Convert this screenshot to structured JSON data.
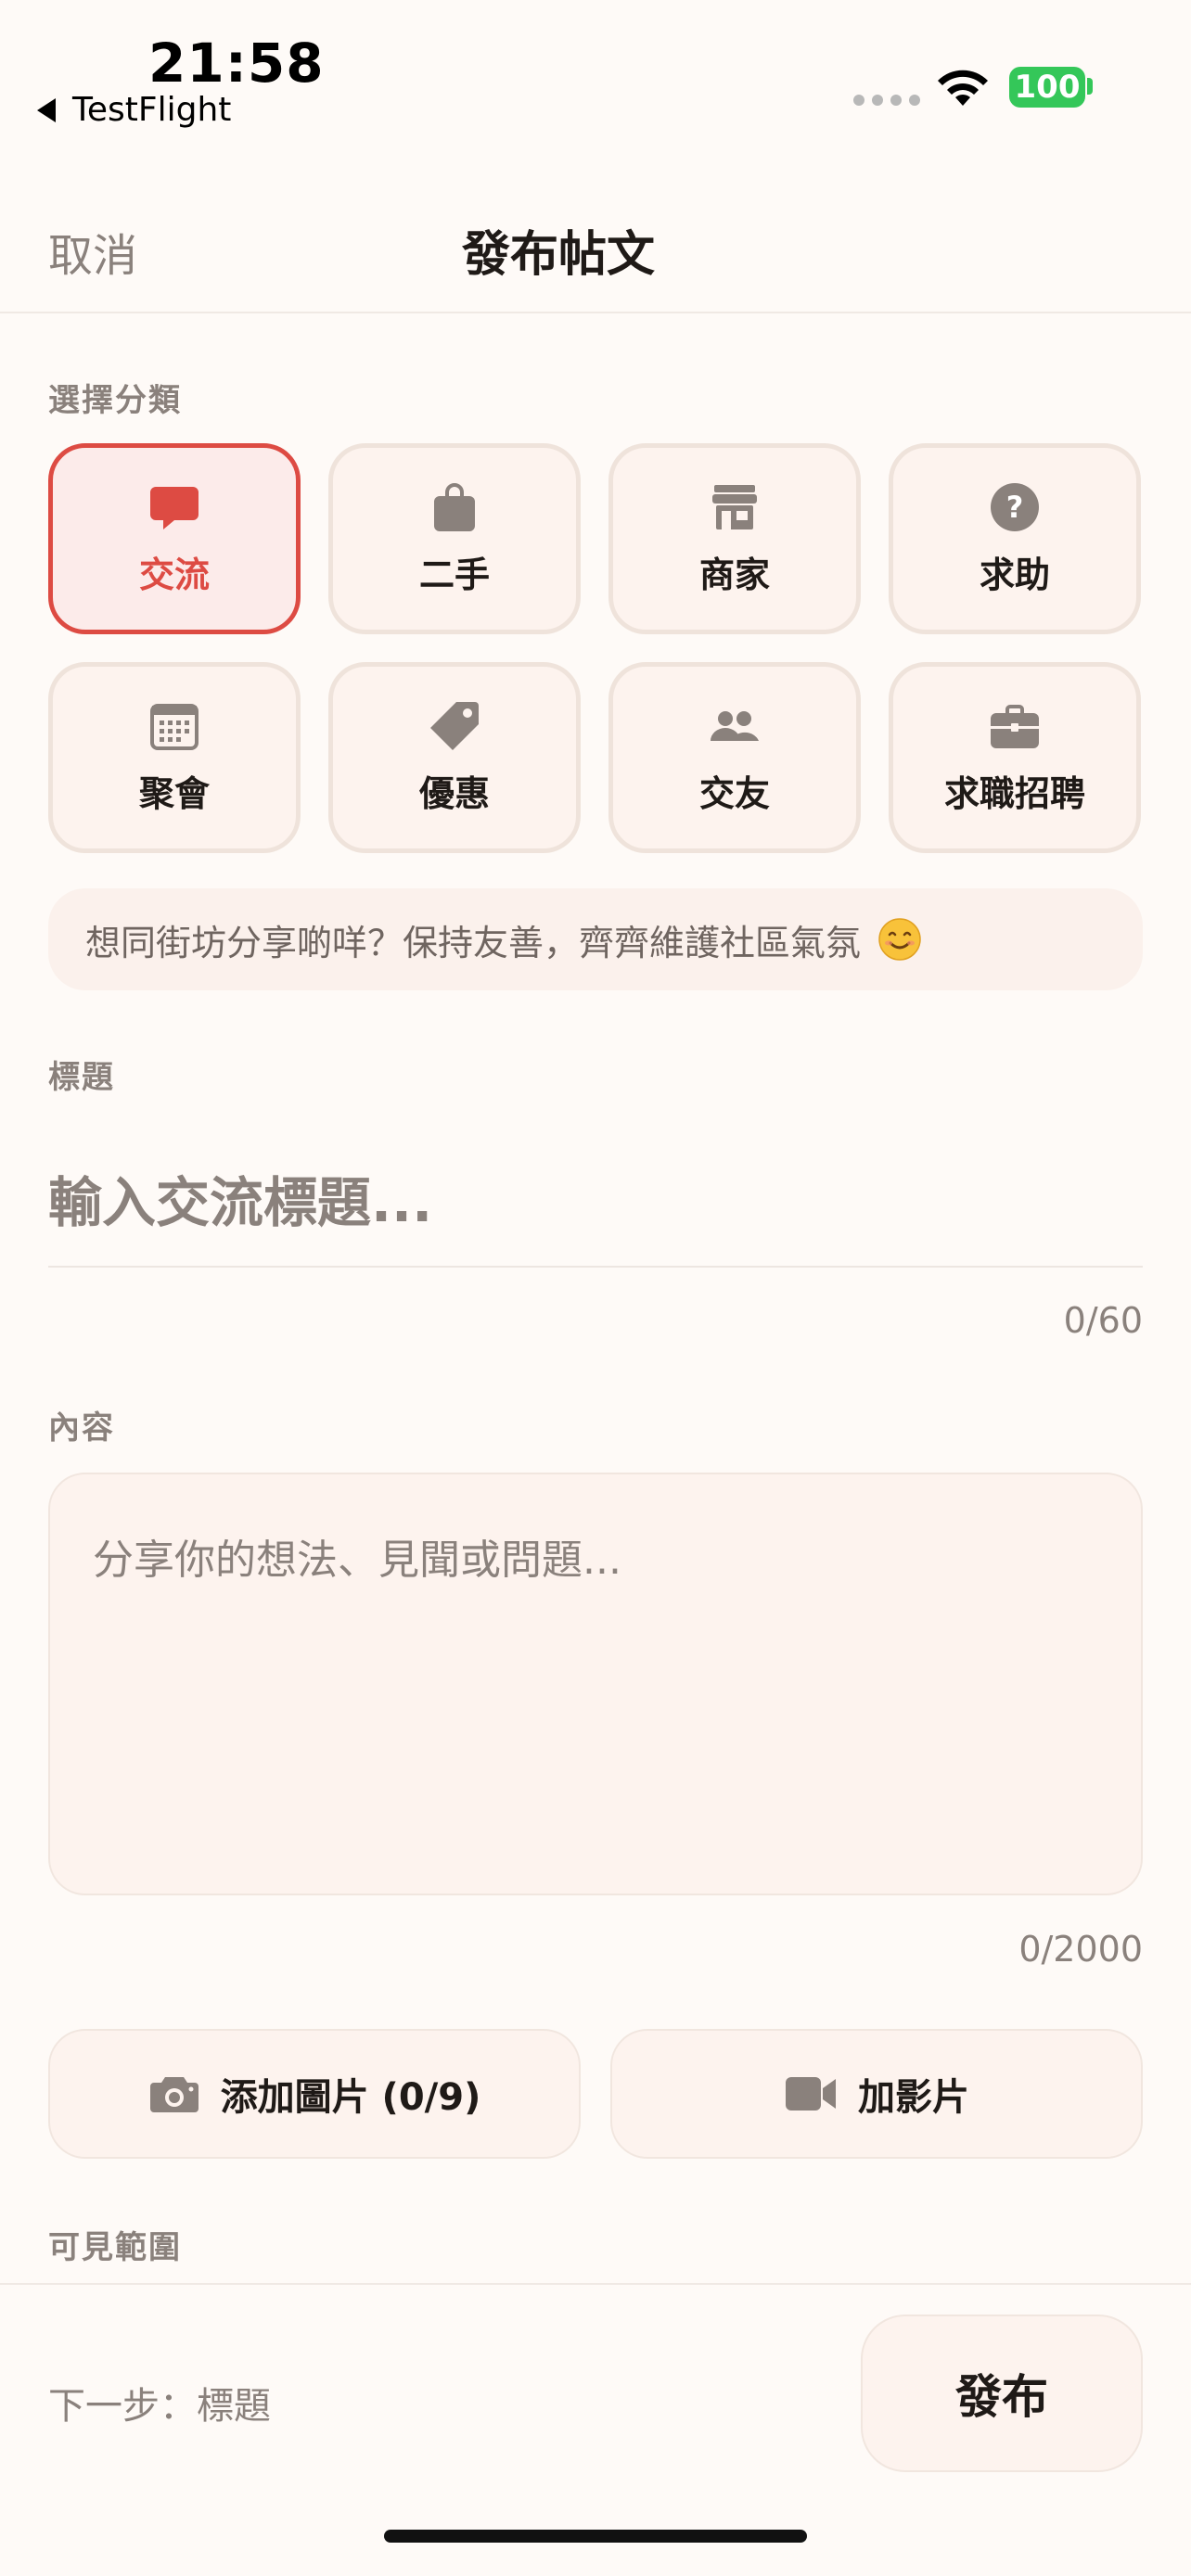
{
  "status_bar": {
    "time": "21:58",
    "back_app": "TestFlight",
    "battery": "100"
  },
  "nav": {
    "cancel": "取消",
    "title": "發布帖文"
  },
  "category_section": {
    "label": "選擇分類",
    "items": [
      {
        "label": "交流",
        "icon": "chat-bubble-icon",
        "selected": true
      },
      {
        "label": "二手",
        "icon": "shopping-bag-icon",
        "selected": false
      },
      {
        "label": "商家",
        "icon": "storefront-icon",
        "selected": false
      },
      {
        "label": "求助",
        "icon": "question-circle-icon",
        "selected": false
      },
      {
        "label": "聚會",
        "icon": "calendar-icon",
        "selected": false
      },
      {
        "label": "優惠",
        "icon": "tag-icon",
        "selected": false
      },
      {
        "label": "交友",
        "icon": "people-icon",
        "selected": false
      },
      {
        "label": "求職招聘",
        "icon": "briefcase-icon",
        "selected": false
      }
    ]
  },
  "tip": {
    "text": "想同街坊分享啲咩？保持友善，齊齊維護社區氣氛"
  },
  "title_section": {
    "label": "標題",
    "placeholder": "輸入交流標題...",
    "counter": "0/60"
  },
  "content_section": {
    "label": "內容",
    "placeholder": "分享你的想法、見聞或問題...",
    "counter": "0/2000"
  },
  "media": {
    "add_image": "添加圖片 (0/9)",
    "add_video": "加影片"
  },
  "visibility_section": {
    "label": "可見範圍"
  },
  "footer": {
    "next_step": "下一步：標題",
    "publish": "發布"
  },
  "colors": {
    "accent": "#dd4b43",
    "background": "#fefaf7",
    "card": "#fdf3ee",
    "icon_gray": "#8a817c"
  }
}
